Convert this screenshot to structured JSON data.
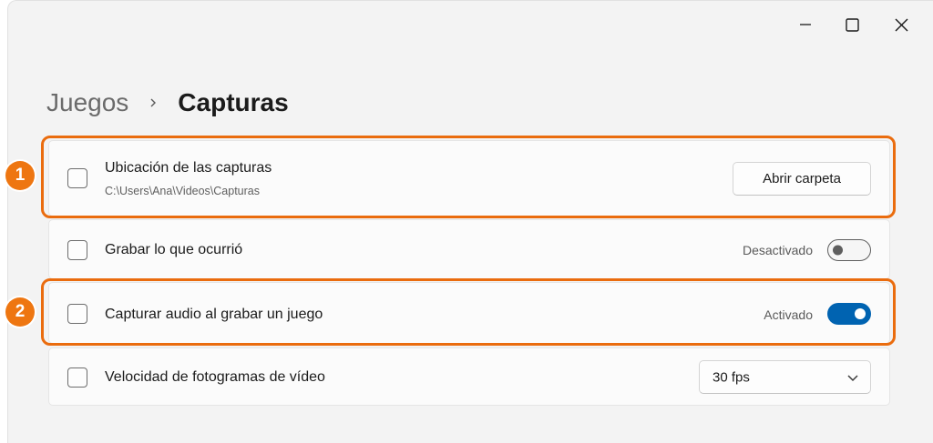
{
  "window_controls": {
    "minimize_icon": "minimize-icon",
    "maximize_icon": "maximize-icon",
    "close_icon": "close-icon"
  },
  "breadcrumb": {
    "parent": "Juegos",
    "separator_icon": "chevron-right-icon",
    "current": "Capturas"
  },
  "settings": {
    "location": {
      "label": "Ubicación de las capturas",
      "path": "C:\\Users\\Ana\\Videos\\Capturas",
      "button_label": "Abrir carpeta"
    },
    "record_what_happened": {
      "label": "Grabar lo que ocurrió",
      "state_label": "Desactivado",
      "on": false
    },
    "capture_audio": {
      "label": "Capturar audio al grabar un juego",
      "state_label": "Activado",
      "on": true
    },
    "framerate": {
      "label": "Velocidad de fotogramas de vídeo",
      "selected": "30 fps"
    }
  },
  "annotations": {
    "marker_1": "1",
    "marker_2": "2",
    "color": "#ea6c0e"
  },
  "colors": {
    "accent": "#0063b1",
    "annotation": "#ee7611"
  }
}
